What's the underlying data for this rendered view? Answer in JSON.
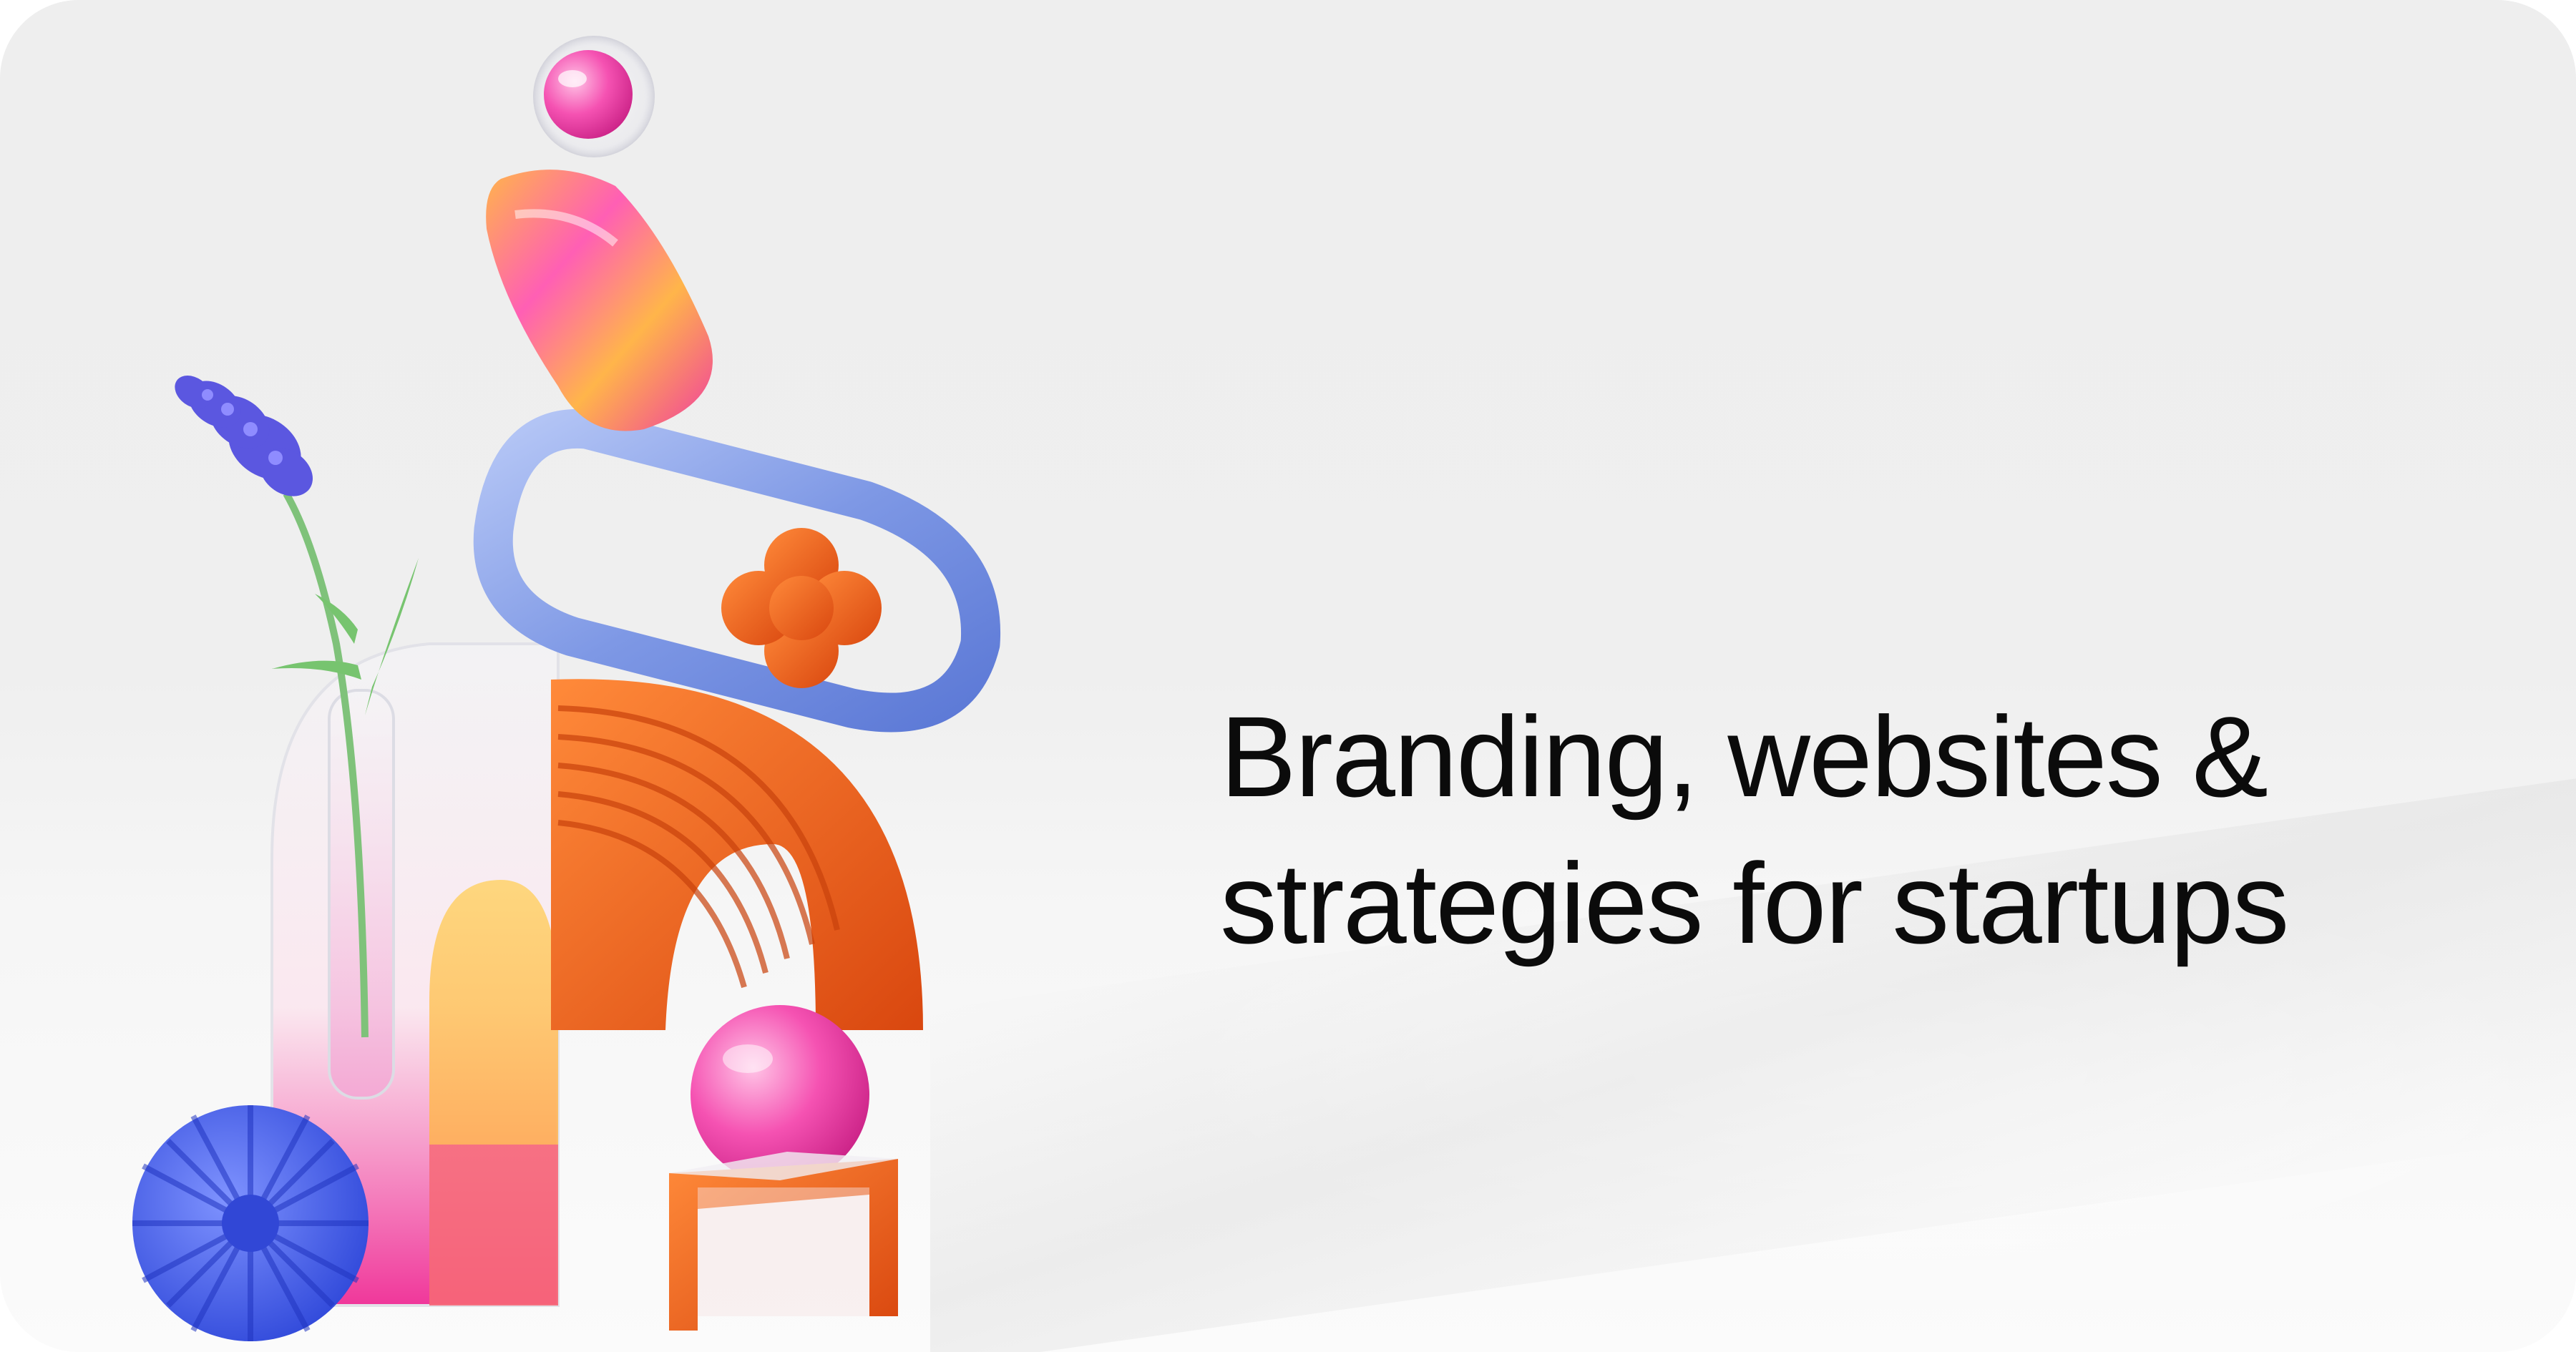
{
  "hero": {
    "headline_line1": "Branding, websites &",
    "headline_line2": "strategies for startups"
  },
  "colors": {
    "background": "#eeeeee",
    "text": "#0b0b0b",
    "orange": "#f26a1f",
    "blue": "#7f9ae6",
    "pink": "#f03ea0",
    "flower": "#5b57e0"
  },
  "illustration": {
    "items": [
      "glass-sphere",
      "swirl-block",
      "blue-ring",
      "orange-clover",
      "orange-arch",
      "pink-sphere",
      "orange-stand",
      "glass-arch",
      "glass-vase",
      "lavender-flower",
      "blue-spiky-ball"
    ]
  }
}
